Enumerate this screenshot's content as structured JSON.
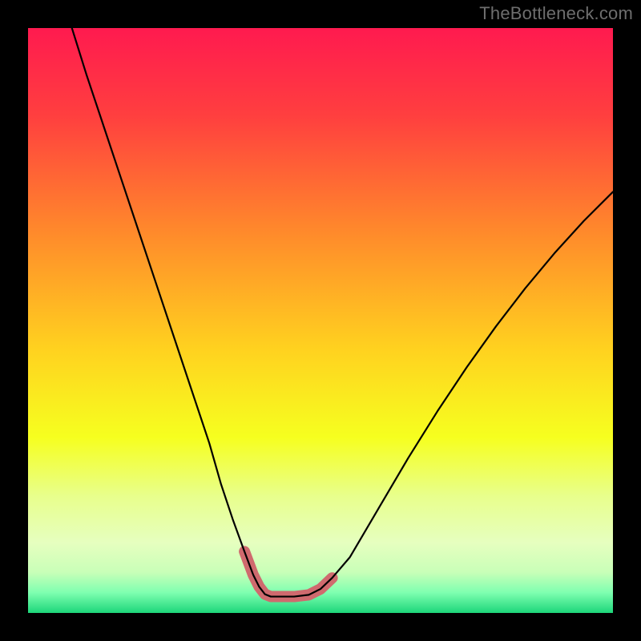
{
  "watermark": "TheBottleneck.com",
  "chart_data": {
    "type": "line",
    "title": "",
    "xlabel": "",
    "ylabel": "",
    "xlim": [
      0,
      1
    ],
    "ylim": [
      0,
      1
    ],
    "gradient_stops": [
      {
        "offset": 0.0,
        "color": "#ff1a4f"
      },
      {
        "offset": 0.15,
        "color": "#ff3f3f"
      },
      {
        "offset": 0.35,
        "color": "#ff8a2b"
      },
      {
        "offset": 0.55,
        "color": "#ffd21f"
      },
      {
        "offset": 0.7,
        "color": "#f6ff1f"
      },
      {
        "offset": 0.8,
        "color": "#e8ff8c"
      },
      {
        "offset": 0.88,
        "color": "#e6ffbf"
      },
      {
        "offset": 0.93,
        "color": "#c9ffb8"
      },
      {
        "offset": 0.965,
        "color": "#7fffb0"
      },
      {
        "offset": 1.0,
        "color": "#1dd67a"
      }
    ],
    "series": [
      {
        "name": "bottleneck_curve",
        "color": "#000000",
        "width": 2.2,
        "x": [
          0.075,
          0.1,
          0.13,
          0.16,
          0.19,
          0.22,
          0.25,
          0.28,
          0.31,
          0.33,
          0.35,
          0.37,
          0.385,
          0.395,
          0.405,
          0.415,
          0.43,
          0.455,
          0.48,
          0.5,
          0.52,
          0.55,
          0.6,
          0.65,
          0.7,
          0.75,
          0.8,
          0.85,
          0.9,
          0.95,
          1.0
        ],
        "y": [
          1.0,
          0.92,
          0.83,
          0.74,
          0.65,
          0.56,
          0.47,
          0.38,
          0.29,
          0.22,
          0.16,
          0.105,
          0.065,
          0.045,
          0.032,
          0.028,
          0.028,
          0.028,
          0.031,
          0.041,
          0.06,
          0.095,
          0.18,
          0.265,
          0.345,
          0.42,
          0.49,
          0.555,
          0.615,
          0.67,
          0.72
        ]
      }
    ],
    "highlight": {
      "name": "valley_highlight",
      "color": "#cf6a6e",
      "width": 14,
      "linecap": "round",
      "x": [
        0.37,
        0.385,
        0.395,
        0.405,
        0.415,
        0.43,
        0.455,
        0.48,
        0.5,
        0.52
      ],
      "y": [
        0.105,
        0.065,
        0.045,
        0.032,
        0.028,
        0.028,
        0.028,
        0.031,
        0.041,
        0.06
      ]
    }
  }
}
